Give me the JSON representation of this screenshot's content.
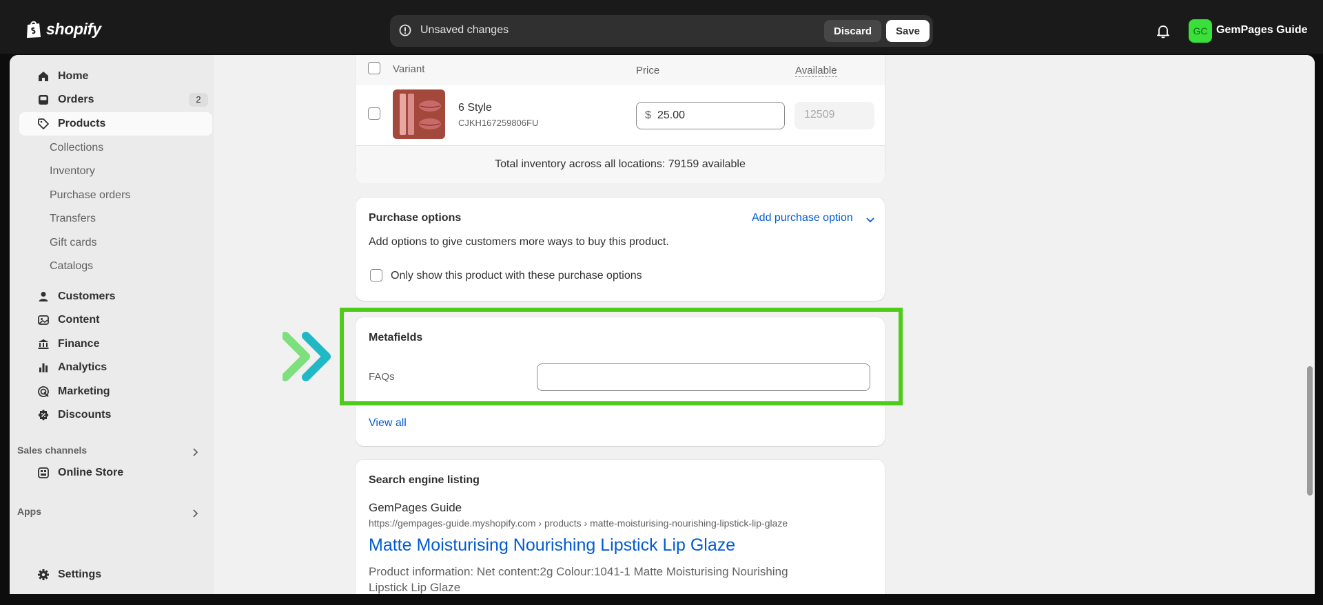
{
  "topbar": {
    "brand": "shopify",
    "unsaved_message": "Unsaved changes",
    "discard_label": "Discard",
    "save_label": "Save",
    "avatar_initials": "GC",
    "shop_name": "GemPages Guide"
  },
  "sidebar": {
    "items": [
      {
        "label": "Home",
        "icon": "home-icon"
      },
      {
        "label": "Orders",
        "icon": "orders-icon",
        "badge": "2"
      },
      {
        "label": "Products",
        "icon": "tag-icon",
        "active": true
      }
    ],
    "product_subitems": [
      "Collections",
      "Inventory",
      "Purchase orders",
      "Transfers",
      "Gift cards",
      "Catalogs"
    ],
    "items2": [
      {
        "label": "Customers",
        "icon": "person-icon"
      },
      {
        "label": "Content",
        "icon": "content-icon"
      },
      {
        "label": "Finance",
        "icon": "bank-icon"
      },
      {
        "label": "Analytics",
        "icon": "bar-chart-icon"
      },
      {
        "label": "Marketing",
        "icon": "target-icon"
      },
      {
        "label": "Discounts",
        "icon": "discount-icon"
      }
    ],
    "sales_channels_label": "Sales channels",
    "online_store_label": "Online Store",
    "apps_label": "Apps",
    "settings_label": "Settings"
  },
  "variants": {
    "col_variant": "Variant",
    "col_price": "Price",
    "col_available": "Available",
    "row": {
      "name": "6 Style",
      "sku": "CJKH167259806FU",
      "currency": "$",
      "price": "25.00",
      "available": "12509"
    },
    "total_inventory": "Total inventory across all locations: 79159 available"
  },
  "purchase_options": {
    "title": "Purchase options",
    "add_link": "Add purchase option",
    "description": "Add options to give customers more ways to buy this product.",
    "checkbox_label": "Only show this product with these purchase options"
  },
  "metafields": {
    "title": "Metafields",
    "faq_label": "FAQs",
    "faq_value": "",
    "view_all": "View all"
  },
  "seo": {
    "title": "Search engine listing",
    "site_name": "GemPages Guide",
    "url": "https://gempages-guide.myshopify.com › products › matte-moisturising-nourishing-lipstick-lip-glaze",
    "page_title": "Matte Moisturising Nourishing Lipstick Lip Glaze",
    "description_line1": "Product information: Net content:2g Colour:1041-1 Matte Moisturising Nourishing",
    "description_line2": "Lipstick Lip Glaze"
  },
  "colors": {
    "highlight": "#4dcc1a",
    "link": "#005bd3",
    "avatar": "#3ae03a"
  }
}
